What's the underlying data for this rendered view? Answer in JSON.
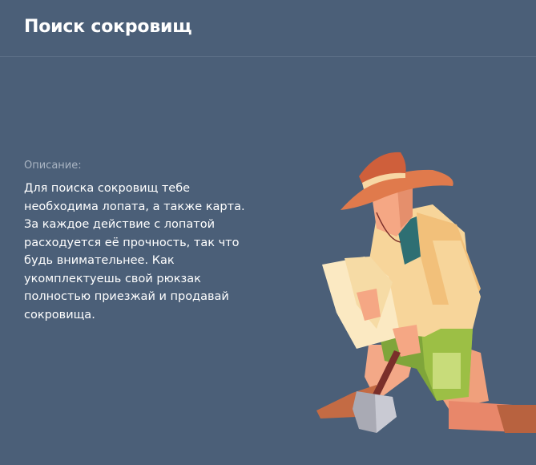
{
  "header": {
    "title": "Поиск сокровищ"
  },
  "description": {
    "label": "Описание:",
    "text": "Для поиска сокровищ тебе необходима лопата, а также карта. За каждое действие с лопатой расходуется её прочность, так что будь внимательнее. Как укомплектуешь свой рюкзак полностью приезжай и продавай сокровища."
  },
  "illustration": {
    "icon": "treasure-hunter-illustration"
  },
  "colors": {
    "background": "#4b5f78",
    "title": "#ffffff",
    "label": "#a9b4c2"
  }
}
